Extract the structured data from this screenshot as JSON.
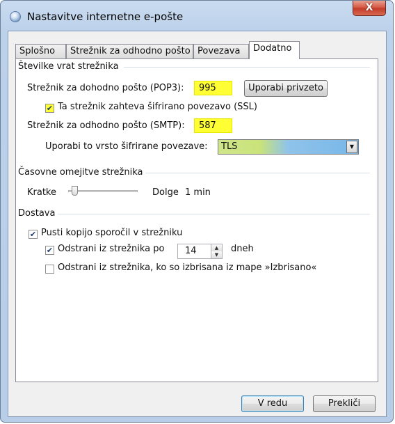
{
  "window": {
    "title": "Nastavitve internetne e-pošte",
    "close_label": "X"
  },
  "tabs": [
    "Splošno",
    "Strežnik za odhodno pošto",
    "Povezava",
    "Dodatno"
  ],
  "active_tab": "Dodatno",
  "ports": {
    "section_title": "Številke vrat strežnika",
    "pop3_label": "Strežnik za dohodno pošto (POP3):",
    "pop3_value": "995",
    "default_button": "Uporabi privzeto",
    "ssl_checkbox_label": "Ta strežnik zahteva šifrirano povezavo (SSL)",
    "ssl_checked": true,
    "smtp_label": "Strežnik za odhodno pošto (SMTP):",
    "smtp_value": "587",
    "encryption_label": "Uporabi to vrsto šifrirane povezave:",
    "encryption_value": "TLS"
  },
  "timeouts": {
    "section_title": "Časovne omejitve strežnika",
    "short_label": "Kratke",
    "long_label": "Dolge",
    "value_label": "1 min",
    "slider_fraction": 0.05
  },
  "delivery": {
    "section_title": "Dostava",
    "leave_copy_label": "Pusti kopijo sporočil v strežniku",
    "leave_copy_checked": true,
    "remove_after_label": "Odstrani iz strežnika po",
    "remove_after_checked": true,
    "days_value": "14",
    "days_unit": "dneh",
    "remove_deleted_label": "Odstrani iz strežnika, ko so izbrisana iz mape »Izbrisano«",
    "remove_deleted_checked": false
  },
  "buttons": {
    "ok": "V redu",
    "cancel": "Prekliči"
  },
  "colors": {
    "highlight": "#ffff33",
    "window_frame": "#bcd1ea",
    "close_button": "#c8402c"
  }
}
